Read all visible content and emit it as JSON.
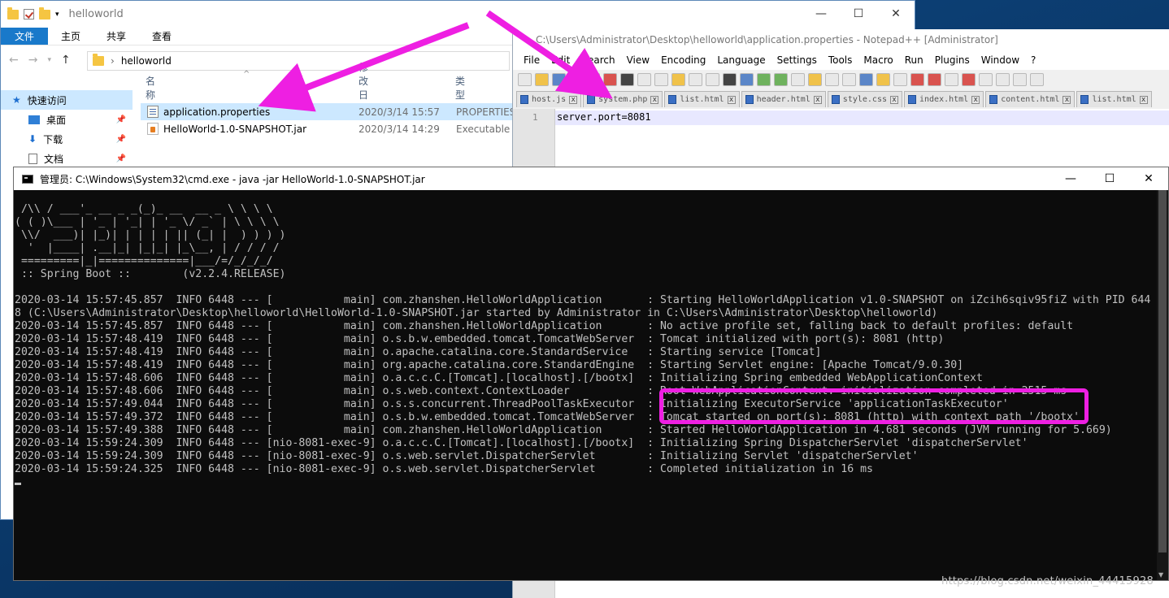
{
  "explorer": {
    "title": "helloworld",
    "ribbon_tabs": [
      "文件",
      "主页",
      "共享",
      "查看"
    ],
    "address": "helloworld",
    "columns": {
      "name": "名称",
      "date": "修改日期",
      "type": "类型"
    },
    "sidebar": [
      {
        "label": "快速访问"
      },
      {
        "label": "桌面"
      },
      {
        "label": "下载"
      },
      {
        "label": "文档"
      }
    ],
    "files": [
      {
        "name": "application.properties",
        "date": "2020/3/14 15:57",
        "type": "PROPERTIES"
      },
      {
        "name": "HelloWorld-1.0-SNAPSHOT.jar",
        "date": "2020/3/14 14:29",
        "type": "Executable J"
      }
    ]
  },
  "npp": {
    "title": "C:\\Users\\Administrator\\Desktop\\helloworld\\application.properties - Notepad++ [Administrator]",
    "menu": [
      "File",
      "Edit",
      "Search",
      "View",
      "Encoding",
      "Language",
      "Settings",
      "Tools",
      "Macro",
      "Run",
      "Plugins",
      "Window",
      "?"
    ],
    "tabs": [
      "host.js",
      "system.php",
      "list.html",
      "header.html",
      "style.css",
      "index.html",
      "content.html",
      "list.html"
    ],
    "line_number": "1",
    "code_line": "server.port=8081"
  },
  "cmd": {
    "title": "管理员: C:\\Windows\\System32\\cmd.exe - java  -jar HelloWorld-1.0-SNAPSHOT.jar",
    "lines": [
      " /\\\\ / ___'_ __ _ _(_)_ __  __ _ \\ \\ \\ \\",
      "( ( )\\___ | '_ | '_| | '_ \\/ _` | \\ \\ \\ \\",
      " \\\\/  ___)| |_)| | | | | || (_| |  ) ) ) )",
      "  '  |____| .__|_| |_|_| |_\\__, | / / / /",
      " =========|_|==============|___/=/_/_/_/",
      " :: Spring Boot ::        (v2.2.4.RELEASE)",
      "",
      "2020-03-14 15:57:45.857  INFO 6448 --- [           main] com.zhanshen.HelloWorldApplication       : Starting HelloWorldApplication v1.0-SNAPSHOT on iZcih6sqiv95fiZ with PID 644",
      "8 (C:\\Users\\Administrator\\Desktop\\helloworld\\HelloWorld-1.0-SNAPSHOT.jar started by Administrator in C:\\Users\\Administrator\\Desktop\\helloworld)",
      "2020-03-14 15:57:45.857  INFO 6448 --- [           main] com.zhanshen.HelloWorldApplication       : No active profile set, falling back to default profiles: default",
      "2020-03-14 15:57:48.419  INFO 6448 --- [           main] o.s.b.w.embedded.tomcat.TomcatWebServer  : Tomcat initialized with port(s): 8081 (http)",
      "2020-03-14 15:57:48.419  INFO 6448 --- [           main] o.apache.catalina.core.StandardService   : Starting service [Tomcat]",
      "2020-03-14 15:57:48.419  INFO 6448 --- [           main] org.apache.catalina.core.StandardEngine  : Starting Servlet engine: [Apache Tomcat/9.0.30]",
      "2020-03-14 15:57:48.606  INFO 6448 --- [           main] o.a.c.c.C.[Tomcat].[localhost].[/bootx]  : Initializing Spring embedded WebApplicationContext",
      "2020-03-14 15:57:48.606  INFO 6448 --- [           main] o.s.web.context.ContextLoader            : Root WebApplicationContext: initialization completed in 2515 ms",
      "2020-03-14 15:57:49.044  INFO 6448 --- [           main] o.s.s.concurrent.ThreadPoolTaskExecutor  : Initializing ExecutorService 'applicationTaskExecutor'",
      "2020-03-14 15:57:49.372  INFO 6448 --- [           main] o.s.b.w.embedded.tomcat.TomcatWebServer  : Tomcat started on port(s): 8081 (http) with context path '/bootx'",
      "2020-03-14 15:57:49.388  INFO 6448 --- [           main] com.zhanshen.HelloWorldApplication       : Started HelloWorldApplication in 4.681 seconds (JVM running for 5.669)",
      "2020-03-14 15:59:24.309  INFO 6448 --- [nio-8081-exec-9] o.a.c.c.C.[Tomcat].[localhost].[/bootx]  : Initializing Spring DispatcherServlet 'dispatcherServlet'",
      "2020-03-14 15:59:24.309  INFO 6448 --- [nio-8081-exec-9] o.s.web.servlet.DispatcherServlet        : Initializing Servlet 'dispatcherServlet'",
      "2020-03-14 15:59:24.325  INFO 6448 --- [nio-8081-exec-9] o.s.web.servlet.DispatcherServlet        : Completed initialization in 16 ms"
    ]
  },
  "watermark": "https://blog.csdn.net/weixin_44415928",
  "colors": {
    "highlight": "#ee1fe2",
    "ribbon_active": "#1979ca",
    "selection": "#cce8ff"
  }
}
